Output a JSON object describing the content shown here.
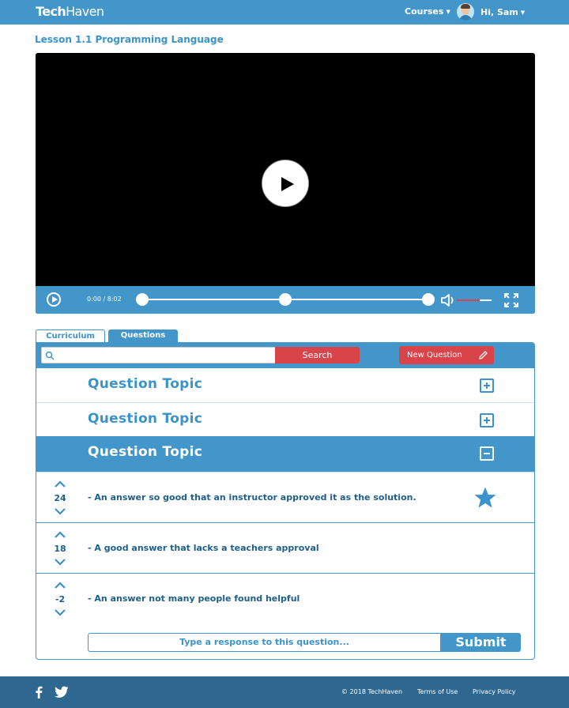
{
  "header": {
    "logo_bold": "Tech",
    "logo_light": "Haven",
    "courses_label": "Courses",
    "greeting": "Hi, Sam"
  },
  "lesson": {
    "title": "Lesson 1.1 Programming Language"
  },
  "player": {
    "time": "0:00 / 8:02",
    "played_fraction": 0.0,
    "buffered_fraction": 0.5,
    "volume_fraction": 0.65
  },
  "tabs": [
    {
      "label": "Curriculum",
      "active": false
    },
    {
      "label": "Questions",
      "active": true
    }
  ],
  "questions": {
    "search_button": "Search",
    "new_question_button": "New Question",
    "topics": [
      {
        "title": "Question Topic",
        "expanded": false
      },
      {
        "title": "Question Topic",
        "expanded": false
      },
      {
        "title": "Question Topic",
        "expanded": true
      }
    ],
    "answers": [
      {
        "votes": "24",
        "text": "- An answer so good that an instructor approved it as the solution.",
        "approved": true
      },
      {
        "votes": "18",
        "text": "- A good answer that lacks a teachers approval",
        "approved": false
      },
      {
        "votes": "-2",
        "text": "- An answer not many people found helpful",
        "approved": false
      }
    ],
    "reply_placeholder": "Type a response to this question...",
    "submit_label": "Submit"
  },
  "footer": {
    "copyright": "© 2018 TechHaven",
    "terms": "Terms of Use",
    "privacy": "Privacy Policy"
  },
  "colors": {
    "primary": "#4396c9",
    "accent_red": "#d9434a",
    "footer": "#2e6891",
    "text_dark": "#1d5f8a"
  },
  "icons": [
    "play-icon",
    "volume-icon",
    "fullscreen-icon",
    "search-icon",
    "pencil-icon",
    "plus-icon",
    "minus-icon",
    "upvote-icon",
    "downvote-icon",
    "star-icon",
    "facebook-icon",
    "twitter-icon"
  ]
}
